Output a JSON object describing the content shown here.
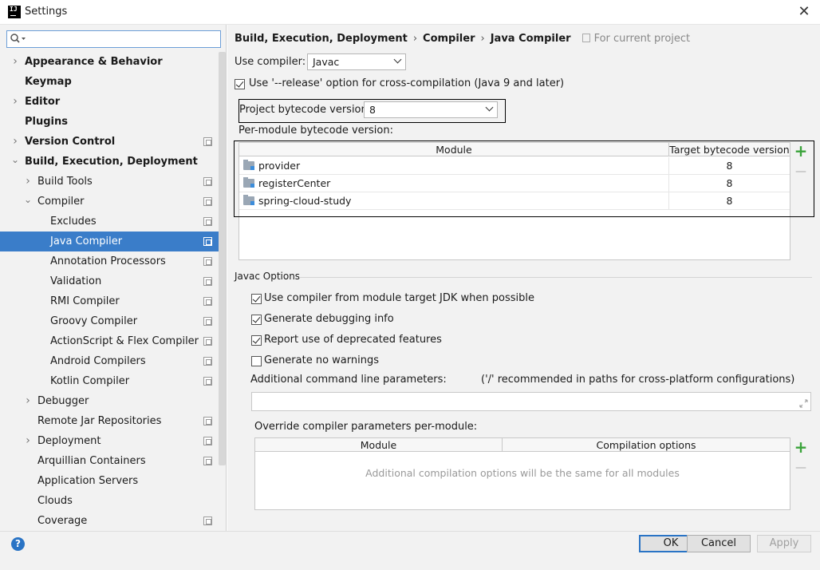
{
  "window": {
    "title": "Settings",
    "close_glyph": "✕",
    "app_icon_text": "IJ"
  },
  "sidebar": {
    "search": {
      "value": "",
      "placeholder": ""
    },
    "items": [
      {
        "label": "Appearance & Behavior",
        "bold": true,
        "arrow": "›",
        "expanded": false,
        "project": false
      },
      {
        "label": "Keymap",
        "bold": true,
        "arrow": "",
        "project": false
      },
      {
        "label": "Editor",
        "bold": true,
        "arrow": "›",
        "expanded": false,
        "project": false
      },
      {
        "label": "Plugins",
        "bold": true,
        "arrow": "",
        "project": false
      },
      {
        "label": "Version Control",
        "bold": true,
        "arrow": "›",
        "expanded": false,
        "project": true
      },
      {
        "label": "Build, Execution, Deployment",
        "bold": true,
        "arrow": "⌄",
        "expanded": true,
        "project": false
      },
      {
        "label": "Build Tools",
        "arrow": "›",
        "project": true
      },
      {
        "label": "Compiler",
        "arrow": "⌄",
        "project": true
      },
      {
        "label": "Excludes",
        "project": true
      },
      {
        "label": "Java Compiler",
        "project": true,
        "selected": true
      },
      {
        "label": "Annotation Processors",
        "project": true
      },
      {
        "label": "Validation",
        "project": true
      },
      {
        "label": "RMI Compiler",
        "project": true
      },
      {
        "label": "Groovy Compiler",
        "project": true
      },
      {
        "label": "ActionScript & Flex Compiler",
        "project": true
      },
      {
        "label": "Android Compilers",
        "project": true
      },
      {
        "label": "Kotlin Compiler",
        "project": true
      },
      {
        "label": "Debugger",
        "arrow": "›"
      },
      {
        "label": "Remote Jar Repositories",
        "project": true
      },
      {
        "label": "Deployment",
        "arrow": "›",
        "project": true
      },
      {
        "label": "Arquillian Containers",
        "project": true
      },
      {
        "label": "Application Servers"
      },
      {
        "label": "Clouds"
      },
      {
        "label": "Coverage",
        "project": true
      }
    ]
  },
  "breadcrumb": {
    "parts": [
      "Build, Execution, Deployment",
      "Compiler",
      "Java Compiler"
    ],
    "separator": "›",
    "for_project": "For current project"
  },
  "compiler": {
    "use_compiler_label": "Use compiler:",
    "use_compiler_value": "Javac",
    "release_option_label": "Use '--release' option for cross-compilation (Java 9 and later)",
    "release_option_checked": true,
    "project_bytecode_label": "Project bytecode version:",
    "project_bytecode_value": "8",
    "per_module_label": "Per-module bytecode version:"
  },
  "module_table": {
    "headers": [
      "Module",
      "Target bytecode version"
    ],
    "rows": [
      {
        "module": "provider",
        "version": "8"
      },
      {
        "module": "registerCenter",
        "version": "8"
      },
      {
        "module": "spring-cloud-study",
        "version": "8"
      }
    ],
    "add_glyph": "+",
    "remove_glyph": "—"
  },
  "javac_options": {
    "title": "Javac Options",
    "checkboxes": [
      {
        "label": "Use compiler from module target JDK when possible",
        "checked": true
      },
      {
        "label": "Generate debugging info",
        "checked": true
      },
      {
        "label": "Report use of deprecated features",
        "checked": true
      },
      {
        "label": "Generate no warnings",
        "checked": false
      }
    ],
    "additional_params_label": "Additional command line parameters:",
    "additional_params_hint": "('/' recommended in paths for cross-platform configurations)",
    "additional_params_value": "",
    "override_label": "Override compiler parameters per-module:",
    "override_headers": [
      "Module",
      "Compilation options"
    ],
    "override_empty": "Additional compilation options will be the same for all modules"
  },
  "footer": {
    "help_glyph": "?",
    "ok": "OK",
    "cancel": "Cancel",
    "apply": "Apply"
  },
  "colors": {
    "selection": "#3a7dc9",
    "add_green": "#3aa33a",
    "accent_blue": "#2a74c5"
  }
}
